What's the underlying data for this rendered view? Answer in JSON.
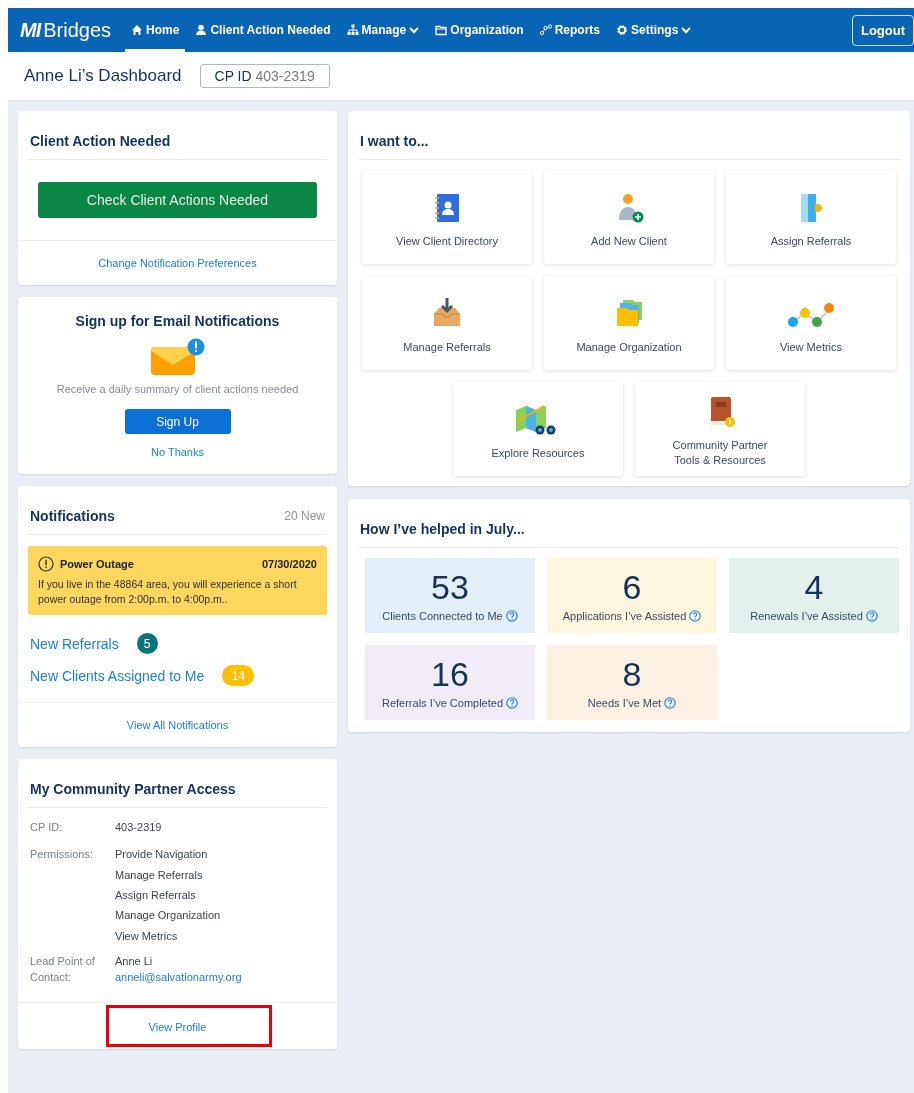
{
  "brand": {
    "logo": "MI",
    "name": "Bridges"
  },
  "nav": [
    {
      "label": "Home",
      "selected": true,
      "dropdown": false
    },
    {
      "label": "Client Action Needed",
      "selected": false,
      "dropdown": false
    },
    {
      "label": "Manage",
      "selected": false,
      "dropdown": true
    },
    {
      "label": "Organization",
      "selected": false,
      "dropdown": false
    },
    {
      "label": "Reports",
      "selected": false,
      "dropdown": false
    },
    {
      "label": "Settings",
      "selected": false,
      "dropdown": true
    }
  ],
  "logout": "Logout",
  "page_title": "Anne Li’s Dashboard",
  "cp_badge": {
    "label": "CP ID",
    "value": "403-2319"
  },
  "client_action": {
    "title": "Client Action Needed",
    "button": "Check Client Actions Needed",
    "link": "Change Notification Preferences"
  },
  "email_signup": {
    "title": "Sign up for Email Notifications",
    "text": "Receive a daily summary of client actions needed",
    "button": "Sign Up",
    "link": "No Thanks"
  },
  "notifications": {
    "title": "Notifications",
    "count": "20 New",
    "alert": {
      "title": "Power Outage",
      "date": "07/30/2020",
      "text": "If you live in the 48864 area, you will experience a short power outage from 2:00p.m. to 4:00p.m.."
    },
    "items": [
      {
        "label": "New Referrals",
        "count": "5",
        "color": "#0b7477"
      },
      {
        "label": "New Clients Assigned to Me",
        "count": "14",
        "color": "#fcc003"
      }
    ],
    "link": "View All Notifications"
  },
  "access": {
    "title": "My Community Partner Access",
    "rows": [
      {
        "label": "CP ID:",
        "values": [
          "403-2319"
        ]
      },
      {
        "label": "Permissions:",
        "values": [
          "Provide Navigation",
          "Manage Referrals",
          "Assign Referrals",
          "Manage Organization",
          "View Metrics"
        ]
      },
      {
        "label": "Lead Point of Contact:",
        "values": [
          "Anne Li"
        ],
        "email": "anneli@salvationarmy.org"
      }
    ],
    "link": "View Profile",
    "highlighted": true
  },
  "actions": {
    "title": "I want to...",
    "tiles": [
      {
        "label": "View Client Directory"
      },
      {
        "label": "Add New Client"
      },
      {
        "label": "Assign Referrals"
      },
      {
        "label": "Manage Referrals"
      },
      {
        "label": "Manage Organization"
      },
      {
        "label": "View Metrics"
      },
      {
        "label": "Explore Resources"
      },
      {
        "label": "Community Partner Tools & Resources"
      }
    ]
  },
  "stats": {
    "title": "How I’ve helped in July...",
    "tiles": [
      {
        "value": "53",
        "label": "Clients Connected to Me",
        "color": "#e3eef9"
      },
      {
        "value": "6",
        "label": "Applications I’ve Assisted",
        "color": "#fdf7e0"
      },
      {
        "value": "4",
        "label": "Renewals I’ve Assisted",
        "color": "#e4f0ec"
      },
      {
        "value": "16",
        "label": "Referrals I’ve Completed",
        "color": "#f1ecf7"
      },
      {
        "value": "8",
        "label": "Needs I’ve Met",
        "color": "#fbf0e4"
      }
    ]
  }
}
